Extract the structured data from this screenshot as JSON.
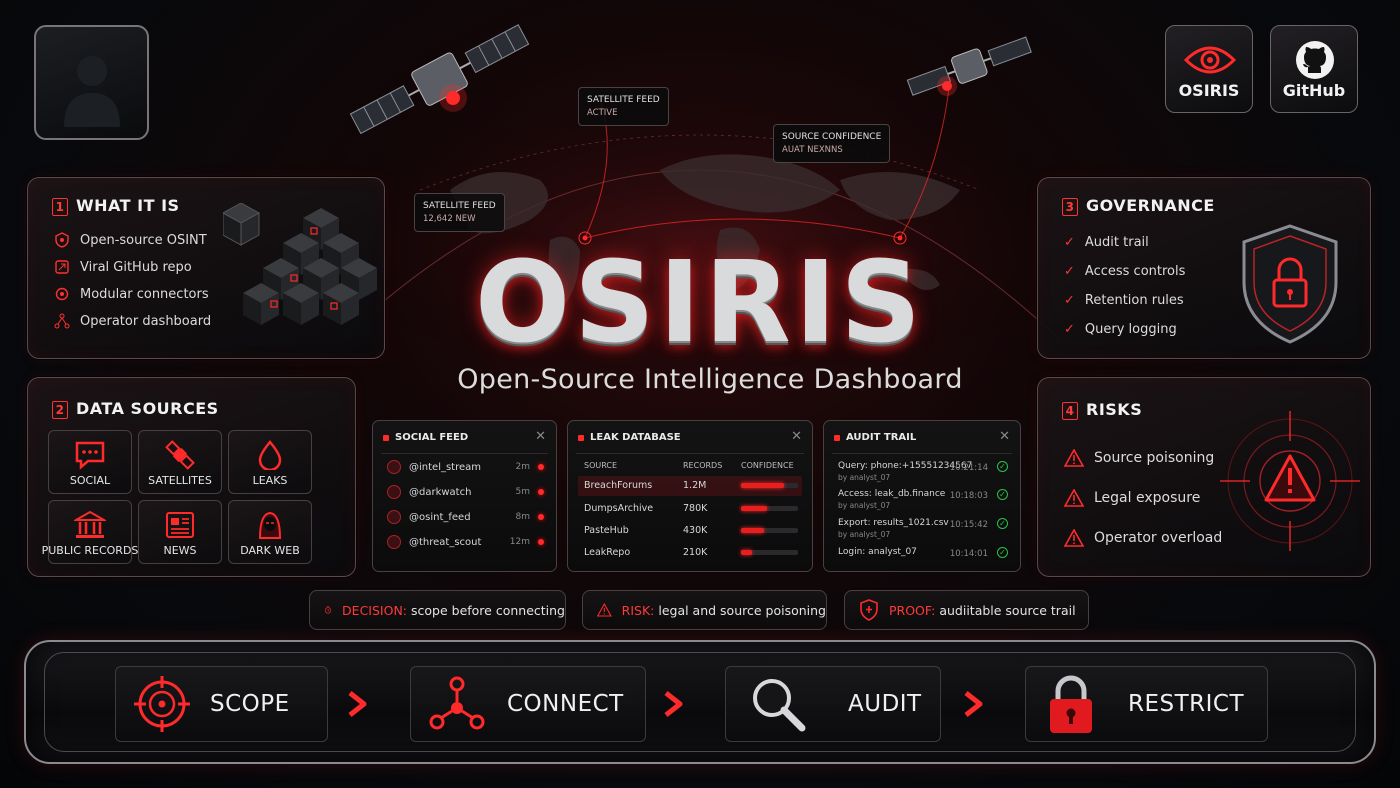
{
  "colors": {
    "accent": "#ff2a2a",
    "ok": "#27c245"
  },
  "brand": {
    "title": "OSIRIS",
    "subtitle": "Open-Source Intelligence Dashboard"
  },
  "top_buttons": {
    "osiris": "OSIRIS",
    "github": "GitHub"
  },
  "hud": {
    "sat_feed_top": {
      "title": "SATELLITE FEED",
      "sub": "ACTIVE"
    },
    "source_conf": {
      "title": "SOURCE CONFIDENCE",
      "sub": "AUAT NEXNNS"
    },
    "sat_feed_left": {
      "title": "SATELLITE FEED",
      "sub": "12,642 NEW"
    }
  },
  "what_it_is": {
    "num": "1",
    "title": "WHAT IT IS",
    "items": [
      "Open-source OSINT",
      "Viral GitHub repo",
      "Modular connectors",
      "Operator dashboard"
    ]
  },
  "data_sources": {
    "num": "2",
    "title": "DATA SOURCES",
    "items": [
      {
        "label": "SOCIAL",
        "icon": "chat-icon"
      },
      {
        "label": "SATELLITES",
        "icon": "satellite-icon"
      },
      {
        "label": "LEAKS",
        "icon": "drop-icon"
      },
      {
        "label": "PUBLIC RECORDS",
        "icon": "building-icon"
      },
      {
        "label": "NEWS",
        "icon": "newspaper-icon"
      },
      {
        "label": "DARK WEB",
        "icon": "hacker-icon"
      }
    ]
  },
  "governance": {
    "num": "3",
    "title": "GOVERNANCE",
    "items": [
      "Audit trail",
      "Access controls",
      "Retention rules",
      "Query logging"
    ]
  },
  "risks": {
    "num": "4",
    "title": "RISKS",
    "items": [
      "Source poisoning",
      "Legal exposure",
      "Operator overload"
    ]
  },
  "social_feed": {
    "title": "SOCIAL FEED",
    "rows": [
      {
        "handle": "@intel_stream",
        "time": "2m"
      },
      {
        "handle": "@darkwatch",
        "time": "5m"
      },
      {
        "handle": "@osint_feed",
        "time": "8m"
      },
      {
        "handle": "@threat_scout",
        "time": "12m"
      }
    ]
  },
  "leak_db": {
    "title": "LEAK DATABASE",
    "headers": [
      "SOURCE",
      "RECORDS",
      "CONFIDENCE"
    ],
    "rows": [
      {
        "source": "BreachForums",
        "records": "1.2M",
        "confidence": 0.75
      },
      {
        "source": "DumpsArchive",
        "records": "780K",
        "confidence": 0.45
      },
      {
        "source": "PasteHub",
        "records": "430K",
        "confidence": 0.4
      },
      {
        "source": "LeakRepo",
        "records": "210K",
        "confidence": 0.2
      }
    ]
  },
  "audit_trail": {
    "title": "AUDIT TRAIL",
    "rows": [
      {
        "text": "Query: phone:+15551234567",
        "by": "by analyst_07",
        "time": "10:21:14"
      },
      {
        "text": "Access: leak_db.finance",
        "by": "by analyst_07",
        "time": "10:18:03"
      },
      {
        "text": "Export: results_1021.csv",
        "by": "by analyst_07",
        "time": "10:15:42"
      },
      {
        "text": "Login: analyst_07",
        "by": "",
        "time": "10:14:01"
      }
    ]
  },
  "chips": [
    {
      "key": "DECISION:",
      "text": "scope before connecting",
      "icon": "target-clock-icon"
    },
    {
      "key": "RISK:",
      "text": "legal and source poisoning",
      "icon": "warning-icon"
    },
    {
      "key": "PROOF:",
      "text": "audiitable source trail",
      "icon": "shield-icon"
    }
  ],
  "steps": [
    "SCOPE",
    "CONNECT",
    "AUDIT",
    "RESTRICT"
  ]
}
